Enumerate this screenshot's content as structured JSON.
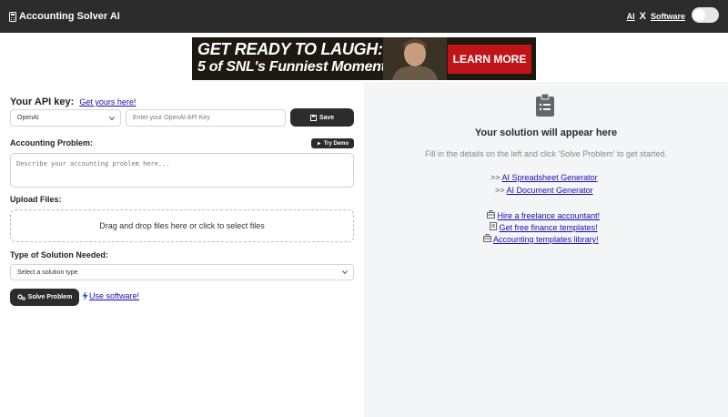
{
  "header": {
    "title": "Accounting Solver AI",
    "link_ai": "AI",
    "separator": "X",
    "link_software": "Software",
    "toggle_state": "off"
  },
  "ad": {
    "line1": "GET READY TO LAUGH:",
    "line2": "5 of SNL's Funniest Moments!",
    "cta": "LEARN MORE",
    "colors": {
      "cta": "#c0141b",
      "background": "#1d1810"
    }
  },
  "form": {
    "api_key_label": "Your API key:",
    "api_key_link": "Get yours here!",
    "provider_selected": "OpenAI",
    "api_key_placeholder": "Enter your OpenAI API Key",
    "save_button": "Save",
    "problem_label": "Accounting Problem:",
    "try_demo_button": "Try Demo",
    "problem_placeholder": "Describe your accounting problem here...",
    "upload_label": "Upload Files:",
    "dropzone_text": "Drag and drop files here or click to select files",
    "solution_type_label": "Type of Solution Needed:",
    "solution_type_selected": "Select a solution type",
    "solve_button": "Solve Problem",
    "use_software_link": "Use software!"
  },
  "panel": {
    "title": "Your solution will appear here",
    "subtitle": "Fill in the details on the left and click 'Solve Problem' to get started.",
    "links": [
      {
        "prefix": ">>",
        "label": "AI Spreadsheet Generator"
      },
      {
        "prefix": ">>",
        "label": "AI Document Generator"
      }
    ],
    "resources": [
      {
        "icon": "briefcase-icon",
        "label": "Hire a freelance accountant!"
      },
      {
        "icon": "document-icon",
        "label": "Get free finance templates!"
      },
      {
        "icon": "briefcase-icon",
        "label": "Accounting templates library!"
      }
    ]
  }
}
